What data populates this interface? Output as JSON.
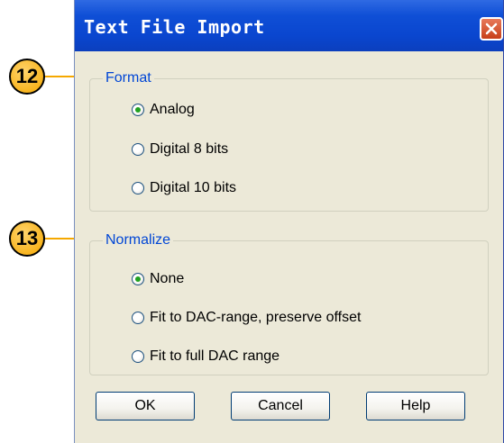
{
  "dialog": {
    "title": "Text File Import",
    "close_icon": "close-icon"
  },
  "format": {
    "legend": "Format",
    "options": [
      {
        "label": "Analog",
        "selected": true
      },
      {
        "label": "Digital 8 bits",
        "selected": false
      },
      {
        "label": "Digital 10 bits",
        "selected": false
      }
    ]
  },
  "normalize": {
    "legend": "Normalize",
    "options": [
      {
        "label": "None",
        "selected": true
      },
      {
        "label": "Fit to DAC-range, preserve offset",
        "selected": false
      },
      {
        "label": "Fit to full DAC range",
        "selected": false
      }
    ]
  },
  "buttons": {
    "ok": "OK",
    "cancel": "Cancel",
    "help": "Help"
  },
  "callouts": {
    "format": "12",
    "normalize": "13"
  },
  "colors": {
    "titlebar": "#0a46cf",
    "legend_text": "#0046d5",
    "callout": "#f5a800",
    "radio_check": "#21a121"
  }
}
